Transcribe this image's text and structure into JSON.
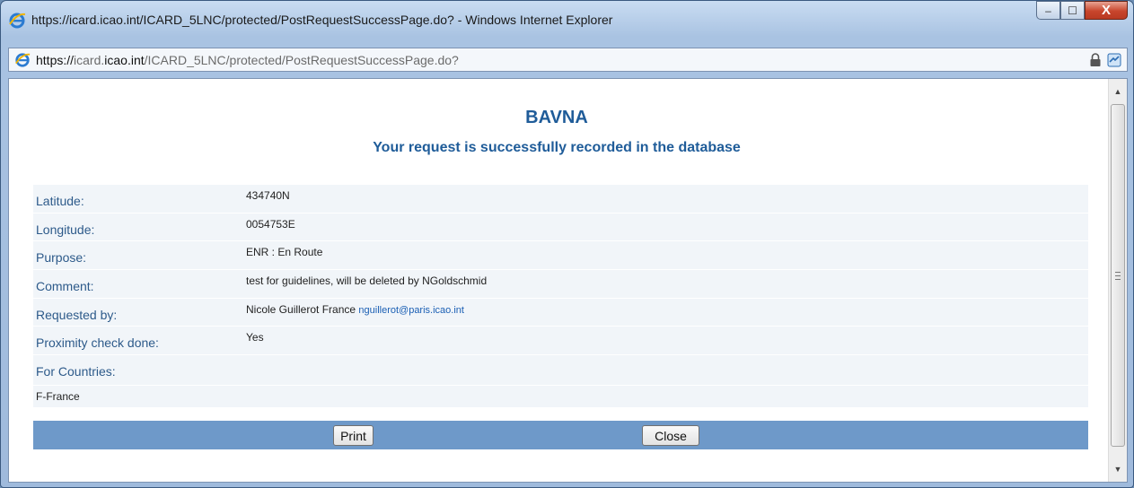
{
  "window": {
    "title": "https://icard.icao.int/ICARD_5LNC/protected/PostRequestSuccessPage.do? - Windows Internet Explorer",
    "controls": {
      "minimize": "‒",
      "maximize": "☐",
      "close": "X"
    }
  },
  "address": {
    "scheme": "https://",
    "pre": "icard.",
    "domain": "icao.int",
    "path": "/ICARD_5LNC/protected/PostRequestSuccessPage.do?"
  },
  "icons": {
    "browser": "internet-explorer-icon",
    "lock": "lock-icon",
    "compat": "compatibility-view-icon"
  },
  "page": {
    "title": "BAVNA",
    "subtitle": "Your request is successfully recorded in the database"
  },
  "details": {
    "latitude": {
      "label": "Latitude:",
      "value": "434740N"
    },
    "longitude": {
      "label": "Longitude:",
      "value": "0054753E"
    },
    "purpose": {
      "label": "Purpose:",
      "value": "ENR : En Route"
    },
    "comment": {
      "label": "Comment:",
      "value": "test for guidelines, will be deleted by NGoldschmid"
    },
    "requested_by": {
      "label": "Requested by:",
      "value": "Nicole Guillerot France",
      "email": "nguillerot@paris.icao.int"
    },
    "proximity": {
      "label": "Proximity check done:",
      "value": "Yes"
    },
    "countries": {
      "label": "For Countries:",
      "items": [
        "F-France"
      ]
    }
  },
  "actions": {
    "print": "Print",
    "close": "Close"
  },
  "colors": {
    "heading": "#1f5c99",
    "label": "#2d5a8a",
    "row_bg": "#f1f5f9",
    "action_bar": "#6e99c9"
  }
}
